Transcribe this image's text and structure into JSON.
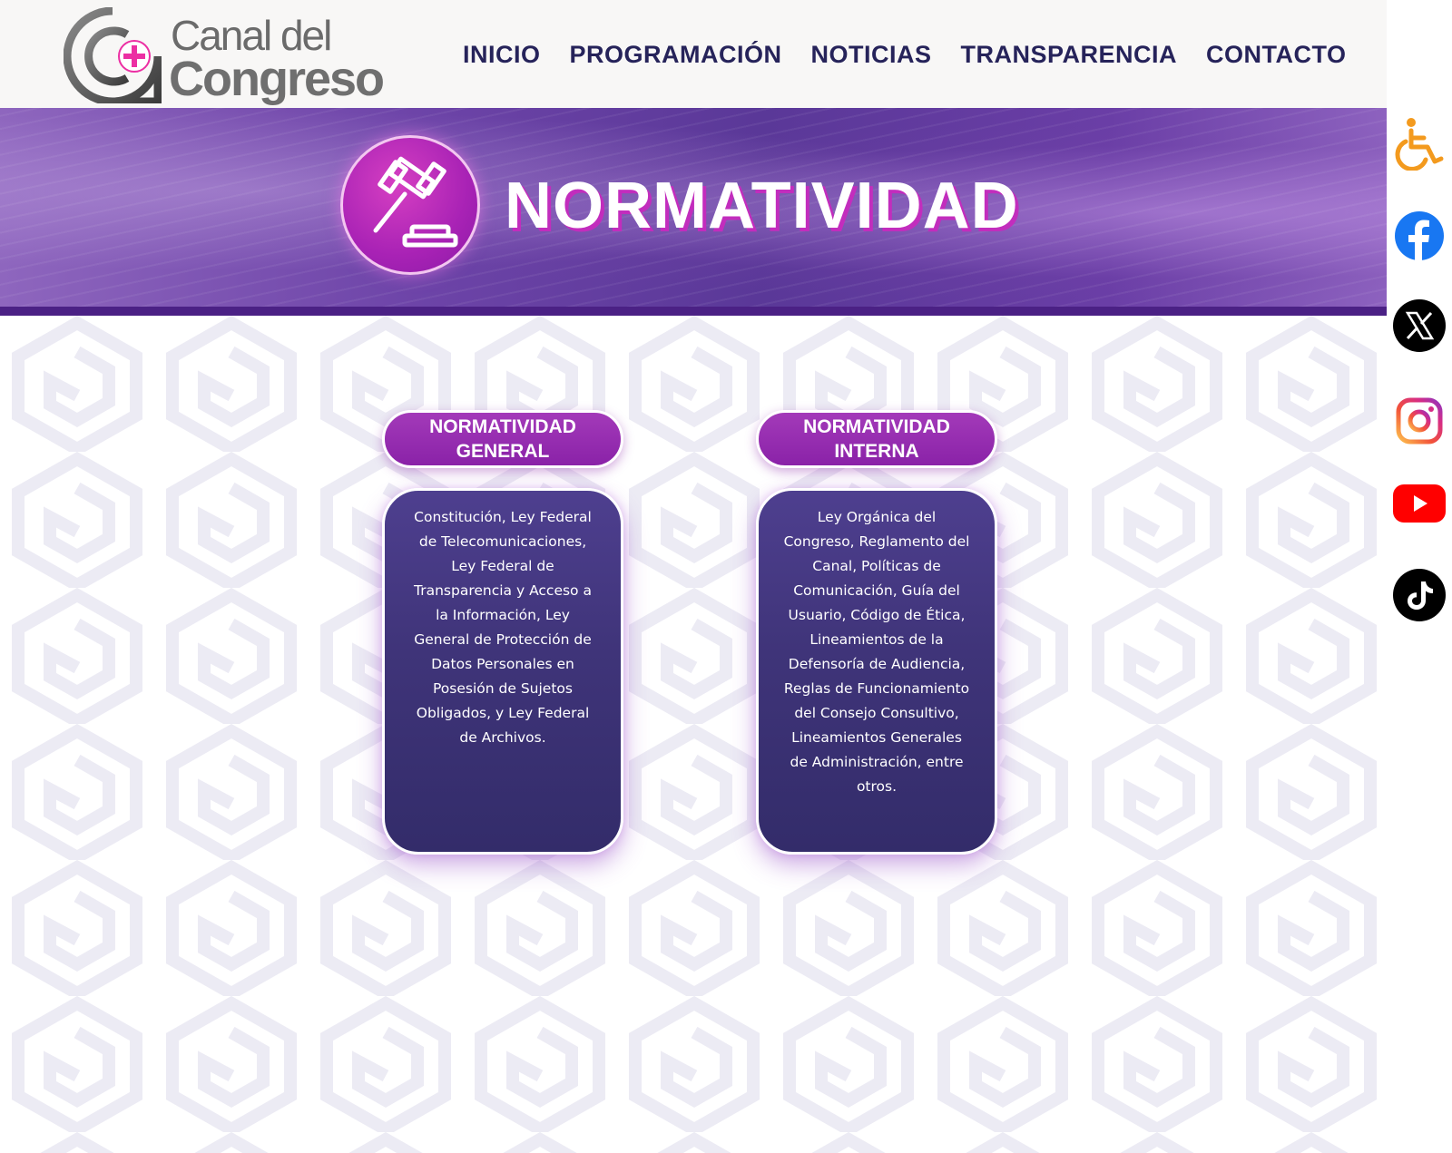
{
  "logo": {
    "line1": "Canal del",
    "line2": "Congreso"
  },
  "nav": {
    "items": [
      {
        "label": "INICIO"
      },
      {
        "label": "PROGRAMACIÓN"
      },
      {
        "label": "NOTICIAS"
      },
      {
        "label": "TRANSPARENCIA"
      },
      {
        "label": "CONTACTO"
      }
    ]
  },
  "banner": {
    "title": "NORMATIVIDAD",
    "icon": "gavel-icon"
  },
  "cards": [
    {
      "title": "NORMATIVIDAD\nGENERAL",
      "body": "Constitución, Ley Federal de Telecomunicaciones, Ley Federal de Transparencia y Acceso a la Información, Ley General de Protección de Datos Personales en Posesión de Sujetos Obligados, y Ley Federal de Archivos."
    },
    {
      "title": "NORMATIVIDAD\nINTERNA",
      "body": "Ley Orgánica del Congreso, Reglamento del Canal, Políticas de Comunicación, Guía del Usuario, Código de Ética, Lineamientos de la Defensoría de Audiencia, Reglas de Funcionamiento del Consejo Consultivo, Lineamientos Generales de Administración, entre otros."
    }
  ],
  "side_icons": [
    {
      "name": "accessibility-icon",
      "color": "#f39a1e"
    },
    {
      "name": "facebook-icon",
      "color": "#1877f2"
    },
    {
      "name": "x-twitter-icon",
      "color": "#000000"
    },
    {
      "name": "instagram-icon",
      "color": "#e1306c"
    },
    {
      "name": "youtube-icon",
      "color": "#ff0000"
    },
    {
      "name": "tiktok-icon",
      "color": "#000000"
    }
  ],
  "colors": {
    "nav_text": "#26235a",
    "accent_magenta": "#a822b5",
    "card_body": "#3f3479",
    "banner_purple": "#6d44a8"
  }
}
